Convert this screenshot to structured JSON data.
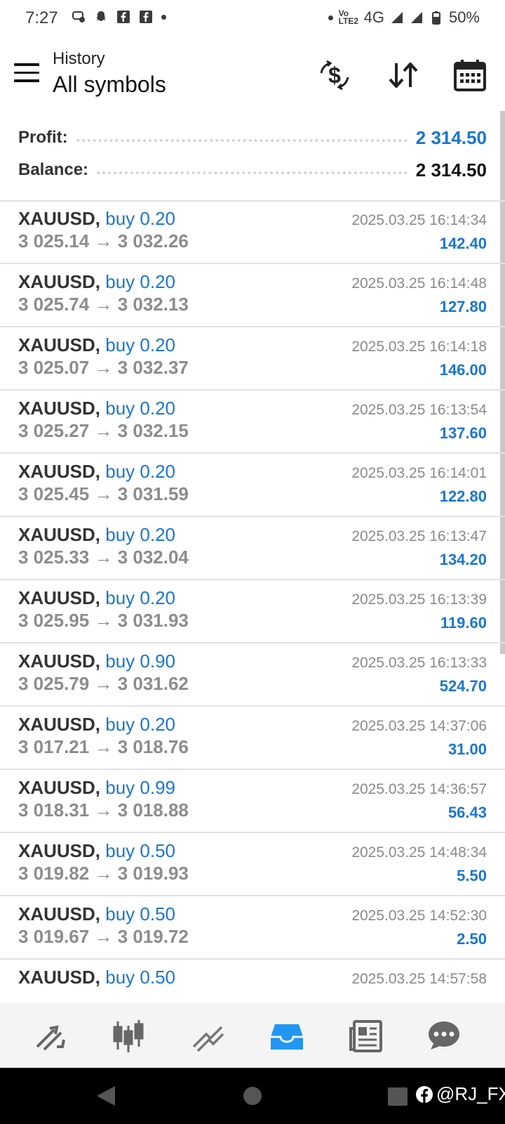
{
  "status_bar": {
    "time": "7:27",
    "network": "4G",
    "volte": "Vo LTE2",
    "battery": "50%"
  },
  "header": {
    "subtitle": "History",
    "title": "All symbols",
    "icons": [
      "menu-icon",
      "dollar-exchange-icon",
      "sort-icon",
      "calendar-icon"
    ]
  },
  "summary": {
    "profit_label": "Profit:",
    "profit_value": "2 314.50",
    "balance_label": "Balance:",
    "balance_value": "2 314.50"
  },
  "deals": [
    {
      "symbol": "XAUUSD,",
      "side": "buy 0.20",
      "open": "3 025.14",
      "close": "3 032.26",
      "time": "2025.03.25 16:14:34",
      "profit": "142.40"
    },
    {
      "symbol": "XAUUSD,",
      "side": "buy 0.20",
      "open": "3 025.74",
      "close": "3 032.13",
      "time": "2025.03.25 16:14:48",
      "profit": "127.80"
    },
    {
      "symbol": "XAUUSD,",
      "side": "buy 0.20",
      "open": "3 025.07",
      "close": "3 032.37",
      "time": "2025.03.25 16:14:18",
      "profit": "146.00"
    },
    {
      "symbol": "XAUUSD,",
      "side": "buy 0.20",
      "open": "3 025.27",
      "close": "3 032.15",
      "time": "2025.03.25 16:13:54",
      "profit": "137.60"
    },
    {
      "symbol": "XAUUSD,",
      "side": "buy 0.20",
      "open": "3 025.45",
      "close": "3 031.59",
      "time": "2025.03.25 16:14:01",
      "profit": "122.80"
    },
    {
      "symbol": "XAUUSD,",
      "side": "buy 0.20",
      "open": "3 025.33",
      "close": "3 032.04",
      "time": "2025.03.25 16:13:47",
      "profit": "134.20"
    },
    {
      "symbol": "XAUUSD,",
      "side": "buy 0.20",
      "open": "3 025.95",
      "close": "3 031.93",
      "time": "2025.03.25 16:13:39",
      "profit": "119.60"
    },
    {
      "symbol": "XAUUSD,",
      "side": "buy 0.90",
      "open": "3 025.79",
      "close": "3 031.62",
      "time": "2025.03.25 16:13:33",
      "profit": "524.70"
    },
    {
      "symbol": "XAUUSD,",
      "side": "buy 0.20",
      "open": "3 017.21",
      "close": "3 018.76",
      "time": "2025.03.25 14:37:06",
      "profit": "31.00"
    },
    {
      "symbol": "XAUUSD,",
      "side": "buy 0.99",
      "open": "3 018.31",
      "close": "3 018.88",
      "time": "2025.03.25 14:36:57",
      "profit": "56.43"
    },
    {
      "symbol": "XAUUSD,",
      "side": "buy 0.50",
      "open": "3 019.82",
      "close": "3 019.93",
      "time": "2025.03.25 14:48:34",
      "profit": "5.50"
    },
    {
      "symbol": "XAUUSD,",
      "side": "buy 0.50",
      "open": "3 019.67",
      "close": "3 019.72",
      "time": "2025.03.25 14:52:30",
      "profit": "2.50"
    },
    {
      "symbol": "XAUUSD,",
      "side": "buy 0.50",
      "open": "",
      "close": "",
      "time": "2025.03.25 14:57:58",
      "profit": ""
    }
  ],
  "arrow_glyph": "→",
  "bottom_nav": [
    {
      "name": "quotes",
      "icon": "quotes-arrows-icon",
      "active": false
    },
    {
      "name": "chart",
      "icon": "candlestick-icon",
      "active": false
    },
    {
      "name": "trade",
      "icon": "trade-trend-icon",
      "active": false
    },
    {
      "name": "history",
      "icon": "inbox-history-icon",
      "active": true
    },
    {
      "name": "news",
      "icon": "newspaper-icon",
      "active": false
    },
    {
      "name": "messages",
      "icon": "chat-bubble-icon",
      "active": false
    }
  ],
  "watermark": "@RJ_FX",
  "colors": {
    "accent_blue": "#1976d2",
    "active_nav": "#2196f3",
    "text_dark": "#333333",
    "text_gray": "#8c8c8c"
  }
}
